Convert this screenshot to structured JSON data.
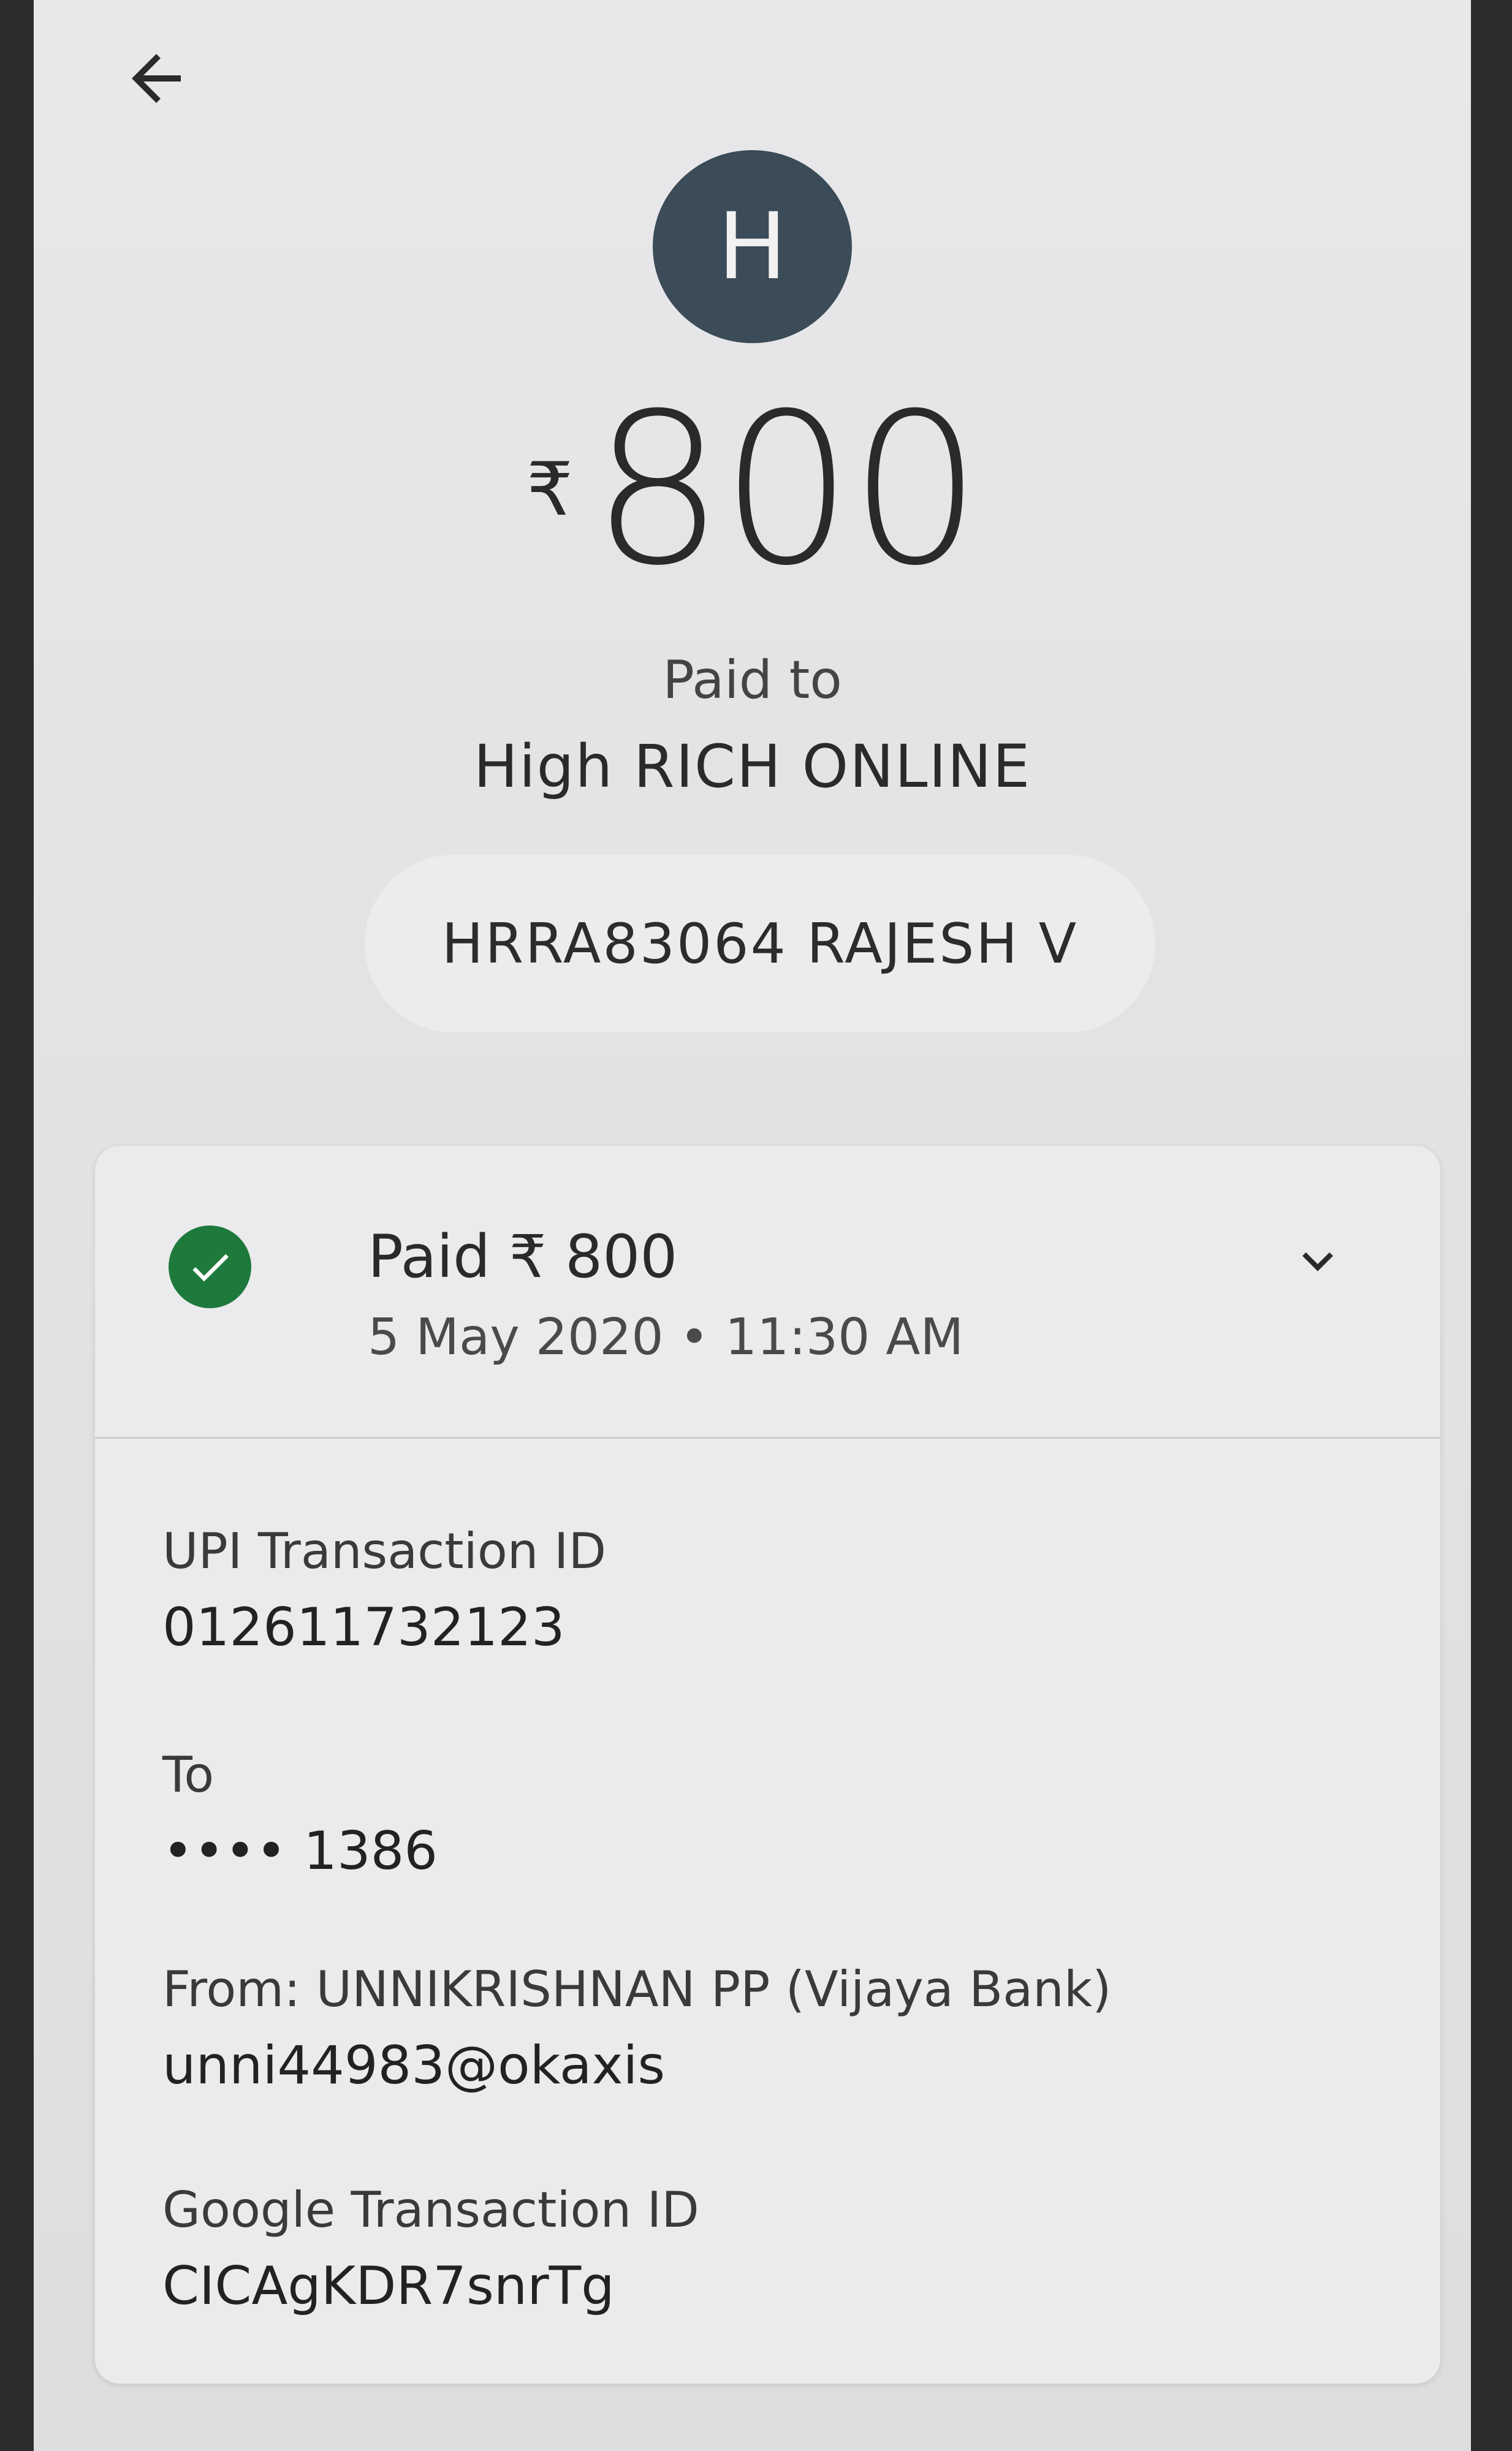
{
  "header": {
    "back_icon": "arrow-left-icon"
  },
  "payee": {
    "avatar_letter": "H",
    "currency_symbol": "₹",
    "amount": "800",
    "paid_to_label": "Paid to",
    "name": "High RICH ONLINE",
    "account_label": "HRRA83064 RAJESH V"
  },
  "transaction": {
    "status_icon": "check-circle-icon",
    "status_color": "#1e7a3c",
    "status_title": "Paid ₹ 800",
    "date_time": "5 May 2020 • 11:30 AM",
    "expand_icon": "chevron-down-icon",
    "details": [
      {
        "label": "UPI Transaction ID",
        "value": "012611732123"
      },
      {
        "label": "To",
        "value": "•••• 1386"
      },
      {
        "label": "From: UNNIKRISHNAN PP (Vijaya Bank)",
        "value": "unni44983@okaxis"
      },
      {
        "label": "Google Transaction ID",
        "value": "CICAgKDR7snrTg"
      }
    ]
  }
}
